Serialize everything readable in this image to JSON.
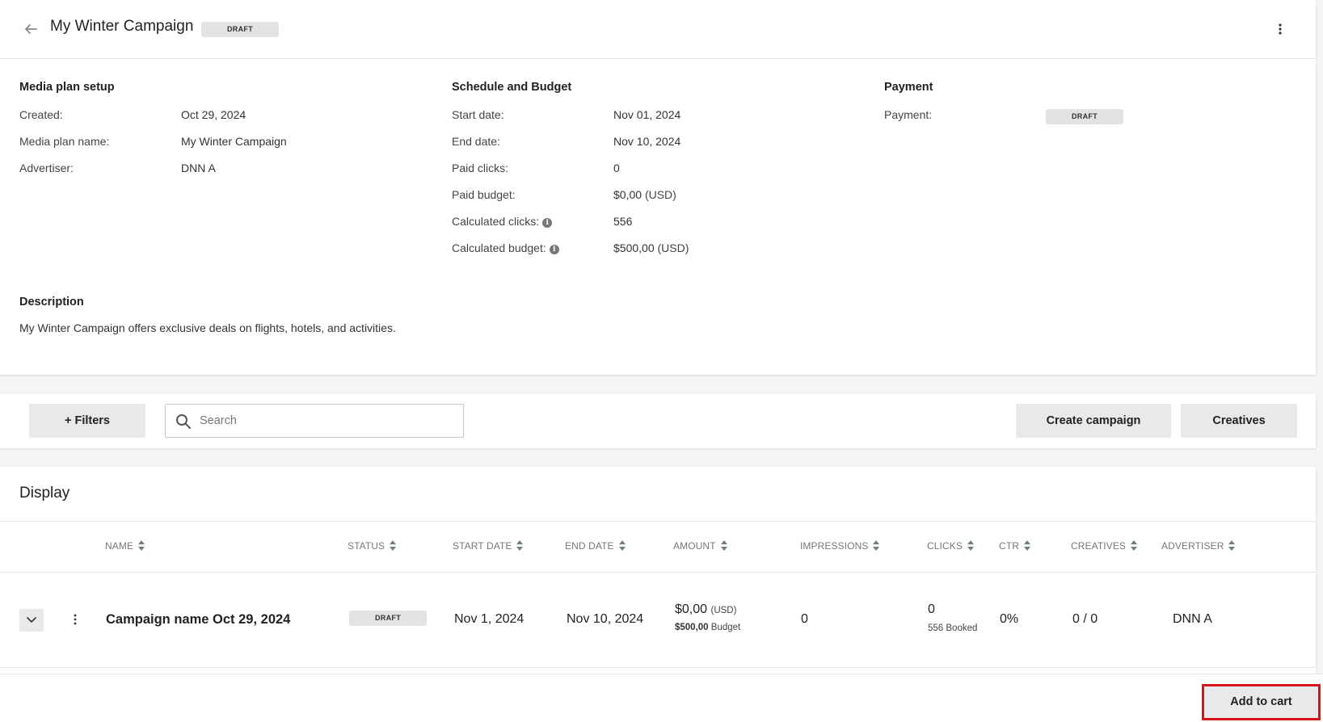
{
  "header": {
    "title": "My Winter Campaign",
    "status_badge": "DRAFT"
  },
  "media_plan_setup": {
    "title": "Media plan setup",
    "rows": [
      {
        "label": "Created:",
        "value": "Oct 29, 2024"
      },
      {
        "label": "Media plan name:",
        "value": "My Winter Campaign"
      },
      {
        "label": "Advertiser:",
        "value": "DNN A"
      }
    ]
  },
  "schedule_budget": {
    "title": "Schedule and Budget",
    "start_date_label": "Start date:",
    "start_date": "Nov 01, 2024",
    "end_date_label": "End date:",
    "end_date": "Nov 10, 2024",
    "paid_clicks_label": "Paid clicks:",
    "paid_clicks": "0",
    "paid_budget_label": "Paid budget:",
    "paid_budget": "$0,00",
    "paid_budget_unit": "(USD)",
    "calc_clicks_label": "Calculated clicks:",
    "calc_clicks": "556",
    "calc_budget_label": "Calculated budget:",
    "calc_budget": "$500,00",
    "calc_budget_unit": "(USD)"
  },
  "payment": {
    "title": "Payment",
    "label": "Payment:",
    "badge": "DRAFT"
  },
  "description": {
    "title": "Description",
    "text": "My Winter Campaign offers exclusive deals on flights, hotels, and activities."
  },
  "toolbar": {
    "filters_label": "+ Filters",
    "search_placeholder": "Search",
    "create_campaign_label": "Create campaign",
    "creatives_label": "Creatives"
  },
  "display": {
    "title": "Display",
    "columns": {
      "name": "NAME",
      "status": "STATUS",
      "start_date": "START DATE",
      "end_date": "END DATE",
      "amount": "AMOUNT",
      "impressions": "IMPRESSIONS",
      "clicks": "CLICKS",
      "ctr": "CTR",
      "creatives": "CREATIVES",
      "advertiser": "ADVERTISER"
    },
    "row": {
      "name": "Campaign name Oct 29, 2024",
      "status": "DRAFT",
      "start_date": "Nov 1, 2024",
      "end_date": "Nov 10, 2024",
      "amount": "$0,00",
      "amount_unit": "(USD)",
      "budget_value": "$500,00",
      "budget_label": "Budget",
      "impressions": "0",
      "clicks": "0",
      "booked": "556 Booked",
      "ctr": "0%",
      "creatives": "0 / 0",
      "advertiser": "DNN A"
    }
  },
  "footer": {
    "add_to_cart_label": "Add to cart"
  },
  "icons": {
    "back": "back-arrow-icon",
    "more": "kebab-icon",
    "info": "info-icon",
    "search": "search-icon",
    "sort": "sort-icon",
    "expand": "chevron-down-icon"
  },
  "colors": {
    "highlight": "#d8141b",
    "badge_bg": "#e2e3e4",
    "button_bg": "#e7e9ea"
  }
}
